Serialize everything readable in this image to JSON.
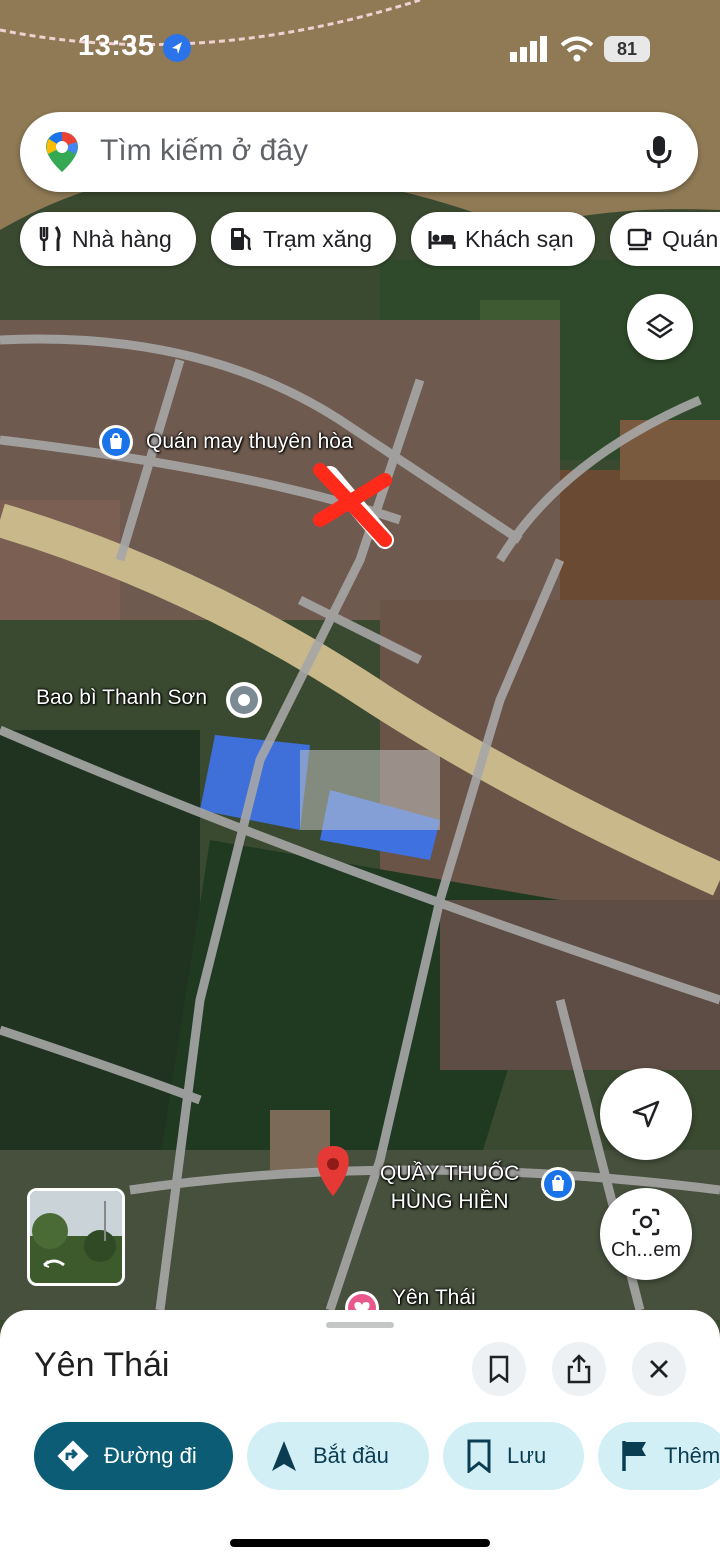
{
  "status_bar": {
    "time": "13:35",
    "battery": "81"
  },
  "search": {
    "placeholder": "Tìm kiếm ở đây"
  },
  "chips": [
    {
      "label": "Nhà hàng",
      "icon": "fork-knife-icon"
    },
    {
      "label": "Trạm xăng",
      "icon": "gas-pump-icon"
    },
    {
      "label": "Khách sạn",
      "icon": "bed-icon"
    },
    {
      "label": "Quán",
      "icon": "coffee-cup-icon"
    }
  ],
  "map_labels": {
    "place1": "Quán may thuyên hòa",
    "place2": "Bao bì Thanh Sơn",
    "place3_line1": "QUẦY THUỐC",
    "place3_line2": "HÙNG HIỀN",
    "place4": "Yên Thái"
  },
  "camera_button": {
    "label": "Ch...em"
  },
  "sheet": {
    "title": "Yên Thái",
    "actions": [
      {
        "label": "Đường đi",
        "icon": "directions-icon"
      },
      {
        "label": "Bắt đầu",
        "icon": "navigation-arrow-icon"
      },
      {
        "label": "Lưu",
        "icon": "bookmark-icon"
      },
      {
        "label": "Thêm",
        "icon": "flag-icon"
      }
    ]
  },
  "colors": {
    "accent": "#0b5c74",
    "chip_bg": "#d3eff6",
    "pin": "#e53935",
    "blue_icon": "#1a73e8",
    "marker_x": "#ff2a1a"
  }
}
